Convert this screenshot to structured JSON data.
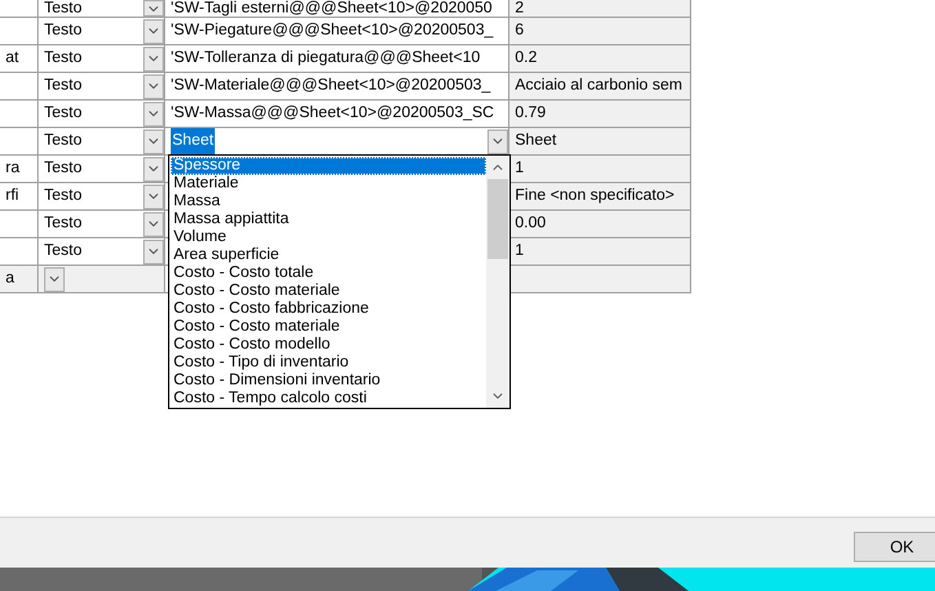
{
  "table": {
    "rows": [
      {
        "name": "",
        "type": "Testo",
        "value": "'SW-Tagli esterni@@@Sheet<10>@2020050",
        "evaluated": "2",
        "editing": false,
        "readonly": false
      },
      {
        "name": "",
        "type": "Testo",
        "value": "'SW-Piegature@@@Sheet<10>@20200503_",
        "evaluated": "6",
        "editing": false,
        "readonly": false
      },
      {
        "name": "at",
        "type": "Testo",
        "value": "'SW-Tolleranza di piegatura@@@Sheet<10",
        "evaluated": "0.2",
        "editing": false,
        "readonly": false
      },
      {
        "name": "",
        "type": "Testo",
        "value": "'SW-Materiale@@@Sheet<10>@20200503_",
        "evaluated": "Acciaio al carbonio sem",
        "editing": false,
        "readonly": false
      },
      {
        "name": "",
        "type": "Testo",
        "value": "'SW-Massa@@@Sheet<10>@20200503_SC",
        "evaluated": "0.79",
        "editing": false,
        "readonly": false
      },
      {
        "name": "",
        "type": "Testo",
        "value": "Sheet",
        "evaluated": "Sheet",
        "editing": true,
        "readonly": false
      },
      {
        "name": "ra",
        "type": "Testo",
        "value": "",
        "evaluated": "1",
        "editing": false,
        "readonly": false
      },
      {
        "name": "rfi",
        "type": "Testo",
        "value": "",
        "evaluated": "Fine <non specificato>",
        "editing": false,
        "readonly": false
      },
      {
        "name": "",
        "type": "Testo",
        "value": "",
        "evaluated": "0.00",
        "editing": false,
        "readonly": false
      },
      {
        "name": "",
        "type": "Testo",
        "value": "",
        "evaluated": "1",
        "editing": false,
        "readonly": false
      },
      {
        "name": "a",
        "type": "",
        "value": "",
        "evaluated": "",
        "editing": false,
        "readonly": true
      }
    ]
  },
  "dropdown": {
    "items": [
      {
        "label": "Spessore",
        "selected": true
      },
      {
        "label": "Materiale",
        "selected": false
      },
      {
        "label": "Massa",
        "selected": false
      },
      {
        "label": "Massa appiattita",
        "selected": false
      },
      {
        "label": "Volume",
        "selected": false
      },
      {
        "label": "Area superficie",
        "selected": false
      },
      {
        "label": "Costo - Costo totale",
        "selected": false
      },
      {
        "label": "Costo - Costo materiale",
        "selected": false
      },
      {
        "label": "Costo - Costo fabbricazione",
        "selected": false
      },
      {
        "label": "Costo - Costo materiale",
        "selected": false
      },
      {
        "label": "Costo - Costo modello",
        "selected": false
      },
      {
        "label": "Costo - Tipo di inventario",
        "selected": false
      },
      {
        "label": "Costo - Dimensioni inventario",
        "selected": false
      },
      {
        "label": "Costo - Tempo calcolo costi",
        "selected": false
      }
    ]
  },
  "buttons": [
    "OK"
  ]
}
